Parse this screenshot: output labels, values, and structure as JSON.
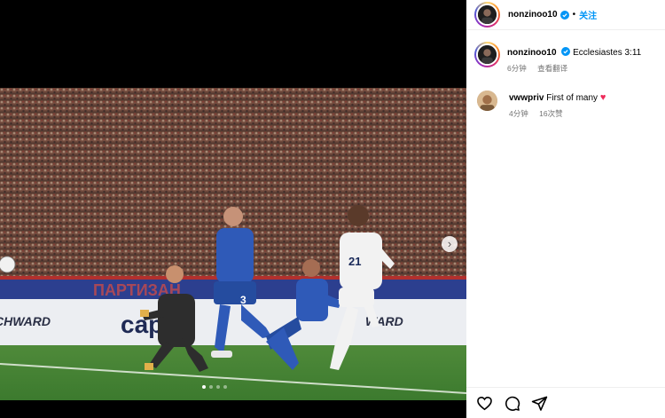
{
  "post": {
    "author": "nonzinoo10",
    "follow_label": "关注",
    "separator": "•",
    "media": {
      "carousel_dots": 4,
      "active_dot": 1,
      "banner_text_left": "CHWARD",
      "banner_text_center": "capi",
      "banner_text_right": "WARD",
      "shirt_number": "21",
      "defender_number": "3"
    }
  },
  "caption": {
    "username": "nonzinoo10",
    "text": "Ecclesiastes 3:11",
    "time": "6分钟",
    "translate_label": "查看翻译"
  },
  "comments": [
    {
      "username": "vwwpriv",
      "text": "First of many",
      "emoji": "♥",
      "time": "4分钟",
      "likes": "16次赞"
    }
  ],
  "colors": {
    "accent": "#0095f6",
    "verified": "#0095f6",
    "heart": "#ee2a5a",
    "meta": "#737373"
  },
  "icons": [
    "verified-badge-icon",
    "next-icon",
    "like-icon",
    "comment-icon",
    "share-icon"
  ]
}
